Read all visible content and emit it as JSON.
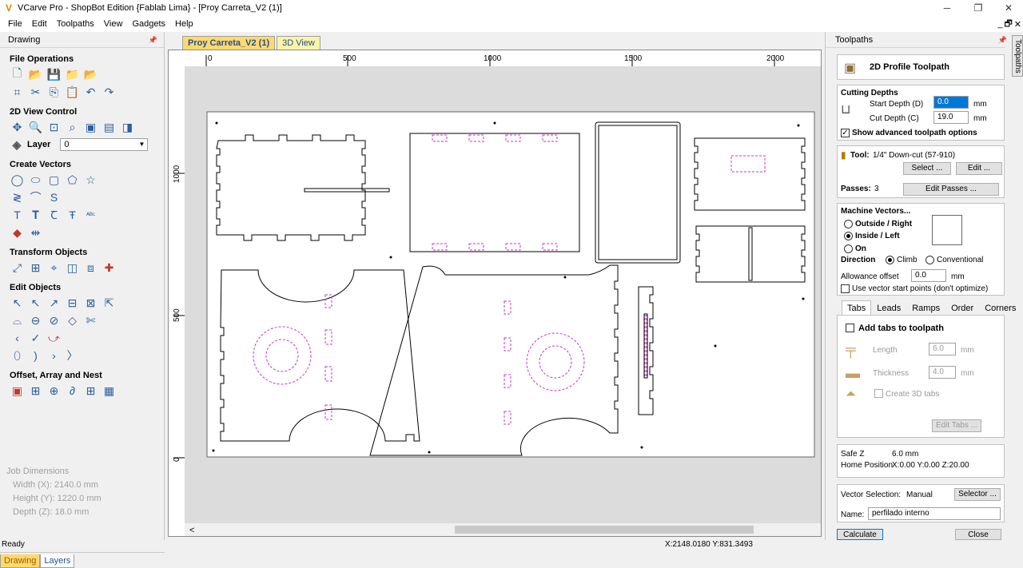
{
  "window": {
    "title": "VCarve Pro - ShopBot Edition {Fablab Lima} - [Proy Carreta_V2 (1)]",
    "minimize": "─",
    "maximize": "❐",
    "close": "✕"
  },
  "menu": [
    "File",
    "Edit",
    "Toolpaths",
    "View",
    "Gadgets",
    "Help"
  ],
  "mdi_controls": [
    "_",
    "🗗",
    "✕"
  ],
  "left_panel": {
    "title": "Drawing",
    "sections": {
      "file_ops": "File Operations",
      "view_control": "2D View Control",
      "layer_label": "Layer",
      "layer_value": "0",
      "create_vectors": "Create Vectors",
      "transform": "Transform Objects",
      "edit_objects": "Edit Objects",
      "offset": "Offset, Array and Nest"
    },
    "job_dims": {
      "title": "Job Dimensions",
      "width": "Width  (X): 2140.0 mm",
      "height": "Height (Y): 1220.0 mm",
      "depth": "Depth  (Z): 18.0 mm"
    },
    "bottom_tabs": [
      "Drawing",
      "Layers"
    ]
  },
  "document_tabs": [
    "Proy Carreta_V2 (1)",
    "3D View"
  ],
  "ruler": {
    "top": [
      "0",
      "500",
      "1000",
      "1500",
      "2000"
    ],
    "left": [
      "1000",
      "500",
      "0"
    ]
  },
  "right_panel": {
    "title": "Toolpaths",
    "side_tab": "Toolpaths",
    "header": "2D Profile Toolpath",
    "cutting_depths": {
      "title": "Cutting Depths",
      "start_label": "Start Depth (D)",
      "start_value": "0.0",
      "cut_label": "Cut Depth (C)",
      "cut_value": "19.0",
      "unit": "mm",
      "advanced": "Show advanced toolpath options"
    },
    "tool": {
      "label": "Tool:",
      "value": "1/4\" Down-cut (57-910)",
      "select": "Select ...",
      "edit": "Edit ...",
      "passes_label": "Passes:",
      "passes_value": "3",
      "edit_passes": "Edit Passes ..."
    },
    "machine_vectors": {
      "title": "Machine Vectors...",
      "outside": "Outside / Right",
      "inside": "Inside / Left",
      "on": "On",
      "direction": "Direction",
      "climb": "Climb",
      "conventional": "Conventional",
      "allowance_label": "Allowance offset",
      "allowance_value": "0.0",
      "unit": "mm",
      "vector_start": "Use vector start points (don't optimize)"
    },
    "subtabs": [
      "Tabs",
      "Leads",
      "Ramps",
      "Order",
      "Corners"
    ],
    "tabs_panel": {
      "add_tabs": "Add tabs to toolpath",
      "length_label": "Length",
      "length_value": "6.0",
      "thickness_label": "Thickness",
      "thickness_value": "4.0",
      "unit": "mm",
      "create_3d": "Create 3D tabs",
      "edit_tabs": "Edit Tabs ..."
    },
    "safe_z_label": "Safe Z",
    "safe_z_value": "6.0 mm",
    "home_label": "Home Position",
    "home_value": "X:0.00 Y:0.00 Z:20.00",
    "vector_sel_label": "Vector Selection:",
    "vector_sel_value": "Manual",
    "selector": "Selector ...",
    "name_label": "Name:",
    "name_value": "perfilado interno",
    "calculate": "Calculate",
    "close": "Close"
  },
  "status": {
    "left": "Ready",
    "coords": "X:2148.0180 Y:831.3493"
  }
}
